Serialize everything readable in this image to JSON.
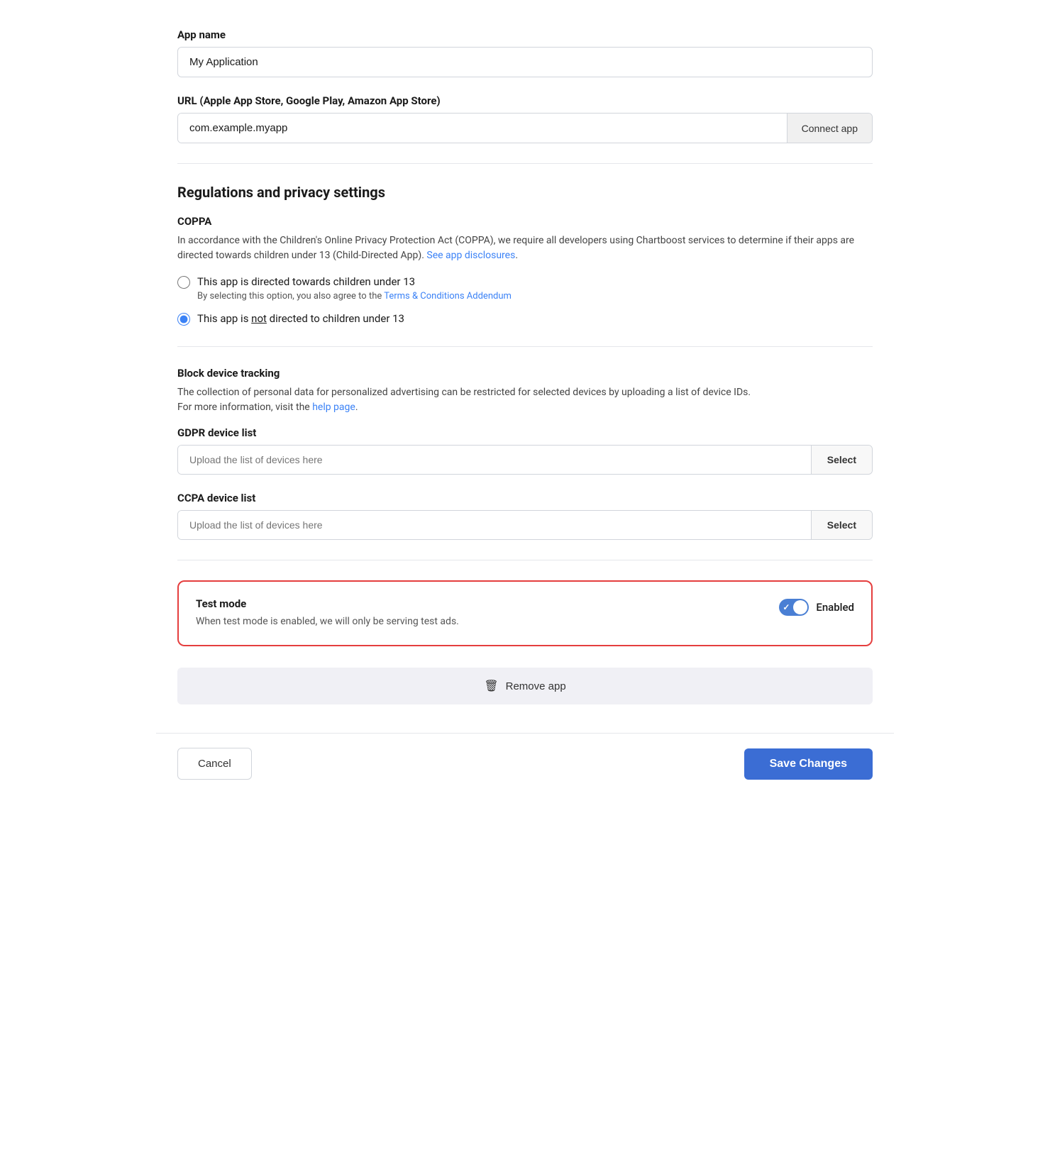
{
  "app_name": {
    "label": "App name",
    "value": "My Application",
    "placeholder": "My Application"
  },
  "url": {
    "label": "URL (Apple App Store, Google Play, Amazon App Store)",
    "value": "com.example.myapp",
    "placeholder": "com.example.myapp",
    "connect_btn": "Connect app"
  },
  "regulations": {
    "section_title": "Regulations and privacy settings",
    "coppa": {
      "title": "COPPA",
      "description_part1": "In accordance with the Children's Online Privacy Protection Act (COPPA), we require all developers using Chartboost services to determine if their apps are directed towards children under 13 (Child-Directed App). ",
      "see_disclosures_link": "See app disclosures",
      "radio_child_label": "This app is directed towards children under 13",
      "radio_child_sublabel_part1": "By selecting this option, you also agree to the ",
      "terms_link": "Terms & Conditions Addendum",
      "radio_not_child_label_prefix": "This app is ",
      "radio_not_child_label_underline": "not",
      "radio_not_child_label_suffix": " directed to children under 13",
      "coppa_child_selected": false,
      "coppa_not_child_selected": true
    },
    "block_tracking": {
      "title": "Block device tracking",
      "description_part1": "The collection of personal data for personalized advertising can be restricted for selected devices by uploading a list of device IDs.",
      "description_part2": "For more information, visit the ",
      "help_link": "help page",
      "description_end": "."
    },
    "gdpr": {
      "label": "GDPR device list",
      "placeholder": "Upload the list of devices here",
      "select_btn": "Select"
    },
    "ccpa": {
      "label": "CCPA device list",
      "placeholder": "Upload the list of devices here",
      "select_btn": "Select"
    }
  },
  "test_mode": {
    "title": "Test mode",
    "description": "When test mode is enabled, we will only be serving test ads.",
    "toggle_label": "Enabled",
    "enabled": true
  },
  "remove_app": {
    "label": "Remove app"
  },
  "footer": {
    "cancel_label": "Cancel",
    "save_label": "Save Changes"
  }
}
